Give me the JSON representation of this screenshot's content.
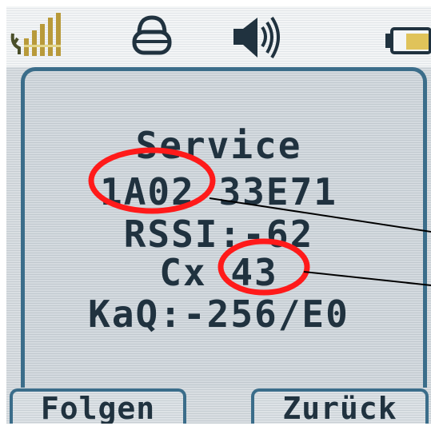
{
  "status_bar": {
    "icons": [
      "signal-strength-icon",
      "lock-icon",
      "speaker-icon",
      "battery-icon"
    ]
  },
  "screen": {
    "title": "Service",
    "ids": "1A02 33E71",
    "rssi": "RSSI:-62",
    "cx": "Cx 43",
    "kaq": "KaQ:-256/E0"
  },
  "softkeys": {
    "left": "Folgen",
    "right": "Zurück"
  },
  "colors": {
    "annotation_red": "#ff1a1a",
    "frame_blue": "#3b6d8a",
    "text": "#20323f",
    "signal_gold": "#b89a3a"
  }
}
